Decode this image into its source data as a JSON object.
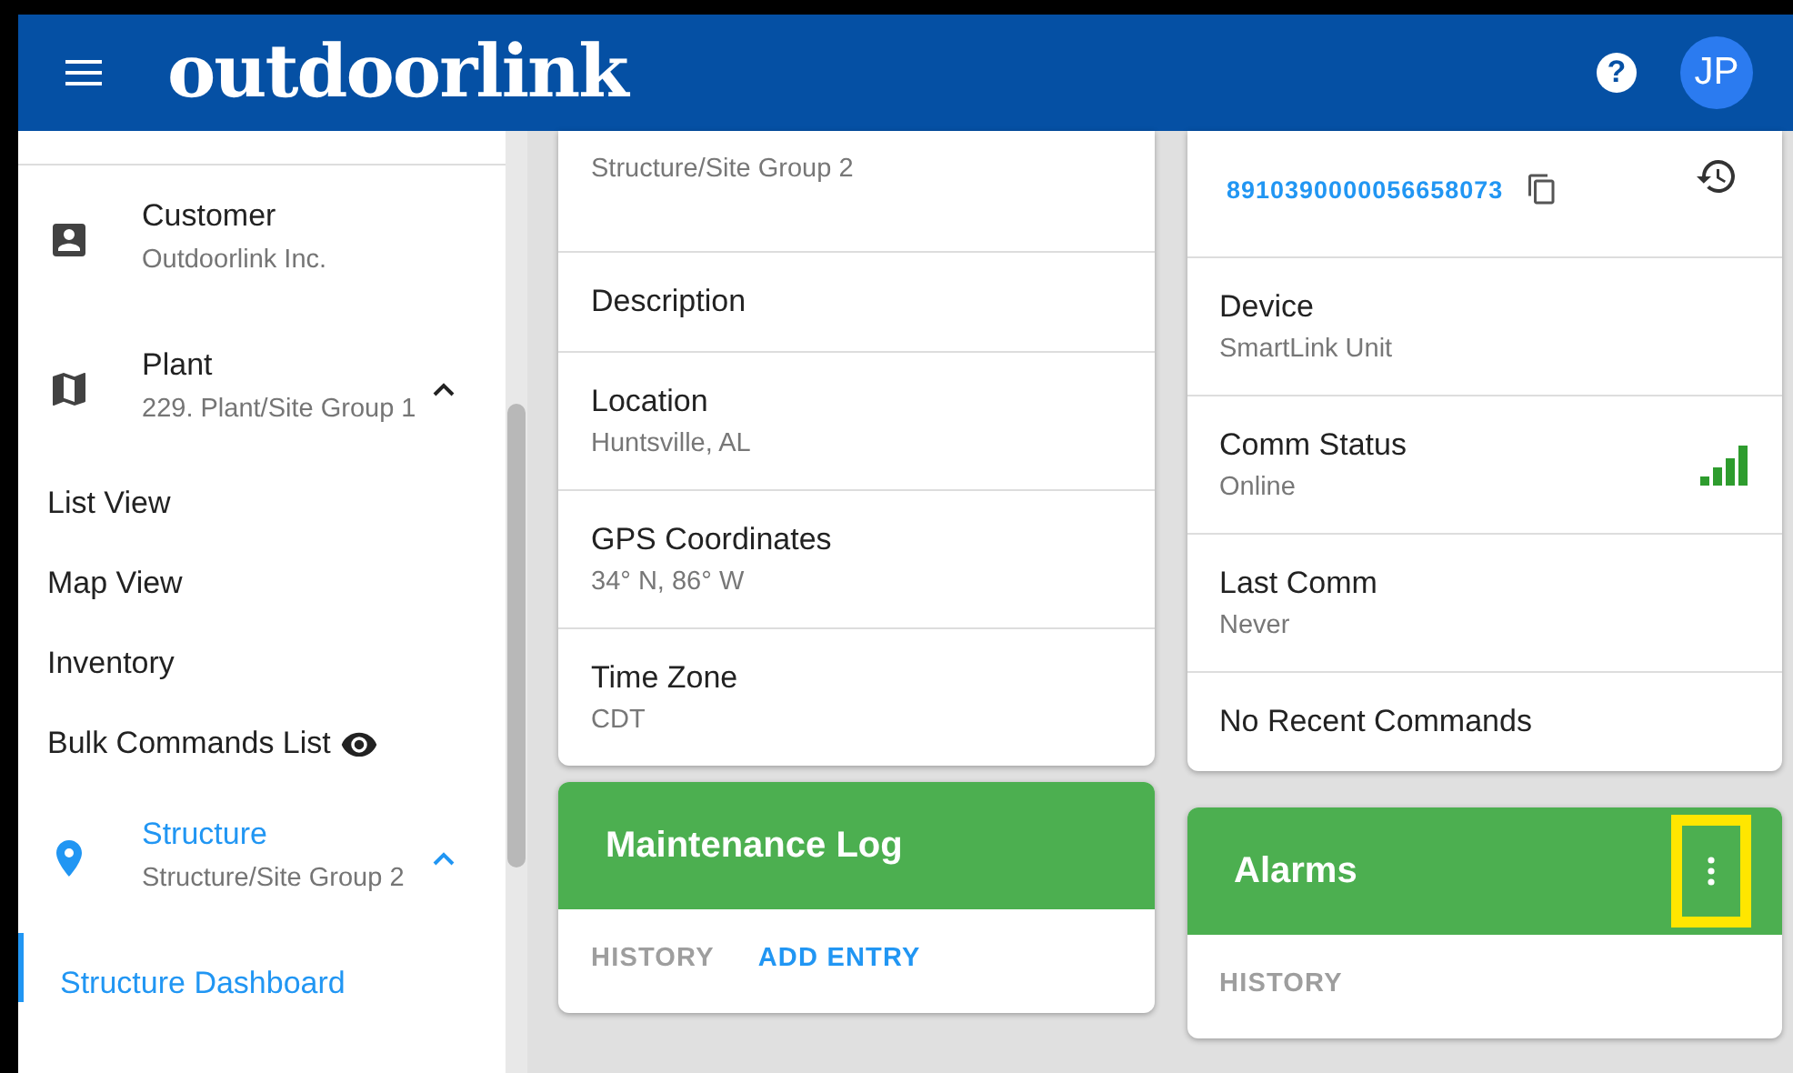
{
  "header": {
    "logo": "outdoorlink",
    "help": "?",
    "avatar": "JP"
  },
  "sidebar": {
    "entities": [
      {
        "kind": "customer",
        "label": "Customer",
        "value": "Outdoorlink Inc.",
        "selected": false,
        "expanded": false
      },
      {
        "kind": "plant",
        "label": "Plant",
        "value": "229. Plant/Site Group 1",
        "selected": false,
        "expanded": true
      },
      {
        "kind": "structure",
        "label": "Structure",
        "value": "Structure/Site Group 2",
        "selected": true,
        "expanded": true
      }
    ],
    "links": [
      {
        "label": "List View",
        "kind": "plain"
      },
      {
        "label": "Map View",
        "kind": "plain"
      },
      {
        "label": "Inventory",
        "kind": "plain"
      },
      {
        "label": "Bulk Commands List",
        "kind": "preview"
      }
    ],
    "sublinks": [
      {
        "label": "Structure Dashboard",
        "selected": true
      }
    ]
  },
  "structure_card": {
    "rows": [
      {
        "value": "Structure/Site Group 2"
      },
      {
        "label": "Description"
      },
      {
        "label": "Location",
        "value": "Huntsville, AL"
      },
      {
        "label": "GPS Coordinates",
        "value": "34° N, 86° W"
      },
      {
        "label": "Time Zone",
        "value": "CDT"
      }
    ]
  },
  "device_card": {
    "iccid": "8910390000056658073",
    "rows": [
      {
        "label": "Device",
        "value": "SmartLink Unit"
      },
      {
        "label": "Comm Status",
        "value": "Online",
        "kind": "signal"
      },
      {
        "label": "Last Comm",
        "value": "Never"
      },
      {
        "label": "No Recent Commands"
      }
    ]
  },
  "maintenance_log": {
    "title": "Maintenance Log",
    "actions": [
      {
        "label": "HISTORY",
        "enabled": false
      },
      {
        "label": "ADD ENTRY",
        "enabled": true
      }
    ]
  },
  "alarms": {
    "title": "Alarms",
    "menu_highlighted": true,
    "actions": [
      {
        "label": "HISTORY",
        "enabled": false
      }
    ]
  }
}
